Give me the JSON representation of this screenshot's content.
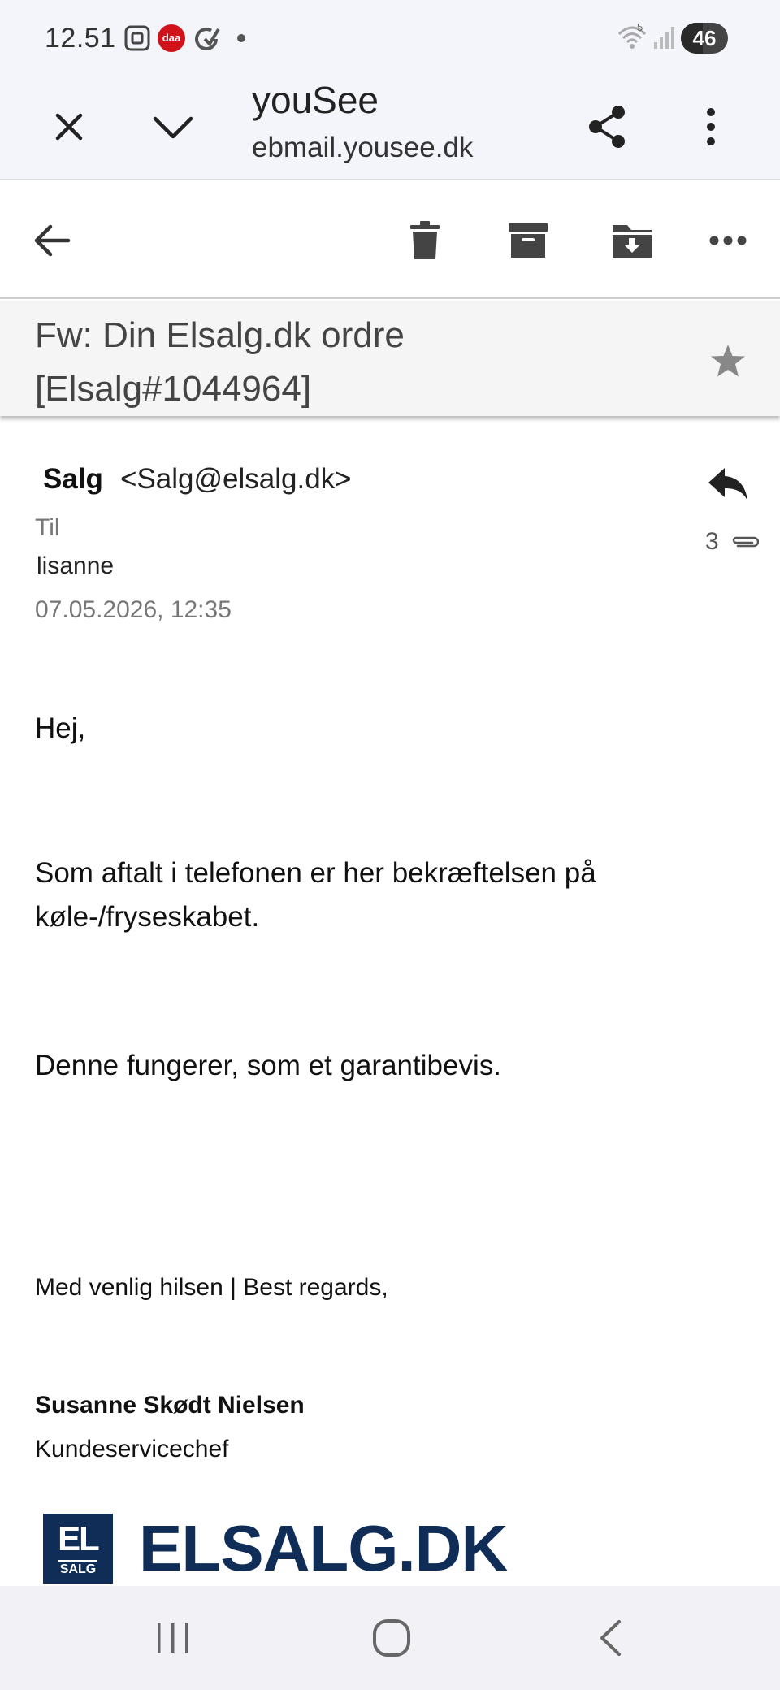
{
  "status_bar": {
    "time": "12.51",
    "carrier_badge": "daa",
    "battery": "46",
    "battery_level": 0.46,
    "wifi_label": "5"
  },
  "browser": {
    "title": "youSee",
    "url": "ebmail.yousee.dk"
  },
  "email": {
    "subject": "Fw: Din Elsalg.dk ordre [Elsalg#1044964]",
    "sender_name": "Salg",
    "sender_email": "<Salg@elsalg.dk>",
    "to_label": "Til",
    "recipient": "lisanne",
    "date": "07.05.2026, 12:35",
    "attachments_count": "3",
    "body": {
      "greeting": "Hej,",
      "paragraph1": "Som aftalt i telefonen er her bekræftelsen på køle-/fryseskabet.",
      "paragraph2": "Denne fungerer, som et garantibevis.",
      "closing": "Med venlig hilsen | Best regards,",
      "signature_name": "Susanne Skødt Nielsen",
      "signature_title": "Kundeservicechef"
    },
    "logo": {
      "box_top": "EL",
      "box_bottom": "SALG",
      "word": "ELSALG.DK",
      "color": "#0f2d57"
    }
  },
  "icons": {
    "close": "close-icon",
    "expand": "chevron-down-icon",
    "share": "share-icon",
    "menu": "more-vert-icon",
    "back": "arrow-back-icon",
    "delete": "trash-icon",
    "archive": "archive-icon",
    "move": "folder-move-icon",
    "more": "more-horiz-icon",
    "star": "star-icon",
    "reply": "reply-icon",
    "attachment": "paperclip-icon"
  }
}
